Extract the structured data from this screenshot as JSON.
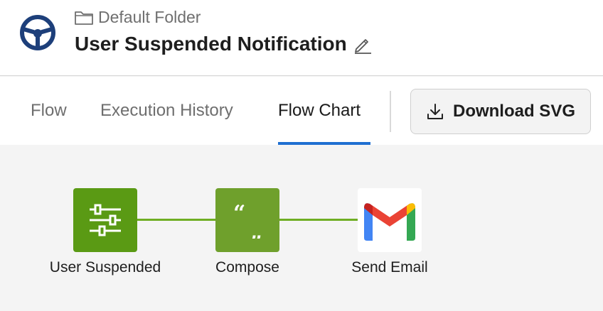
{
  "header": {
    "folder_name": "Default Folder",
    "title": "User Suspended Notification"
  },
  "tabs": [
    {
      "label": "Flow",
      "active": false
    },
    {
      "label": "Execution History",
      "active": false
    },
    {
      "label": "Flow Chart",
      "active": true
    }
  ],
  "toolbar": {
    "download_label": "Download SVG"
  },
  "flow": {
    "nodes": [
      {
        "label": "User Suspended",
        "icon": "sliders-icon",
        "color": "#5a9a14"
      },
      {
        "label": "Compose",
        "icon": "quotes-icon",
        "color": "#6fa02c"
      },
      {
        "label": "Send Email",
        "icon": "gmail-icon",
        "color": "#ffffff"
      }
    ],
    "connector_color": "#6fae24"
  },
  "colors": {
    "accent": "#1f6fd1",
    "logo": "#1d3f7a"
  }
}
